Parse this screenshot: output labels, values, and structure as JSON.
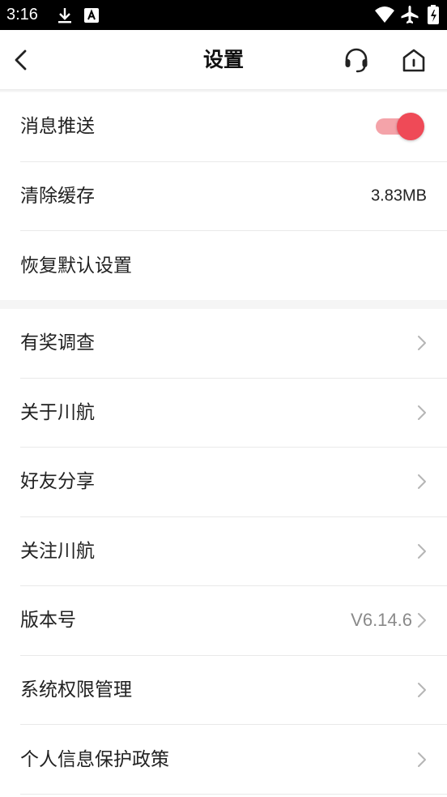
{
  "status_bar": {
    "time": "3:16",
    "icons": [
      "download-icon",
      "a-notification-icon",
      "wifi-icon",
      "airplane-icon",
      "battery-icon"
    ]
  },
  "header": {
    "title": "设置",
    "back_icon": "chevron-left-icon",
    "service_icon": "headset-icon",
    "home_icon": "home-icon"
  },
  "settings_group_1": [
    {
      "label": "消息推送",
      "control": "toggle",
      "on": true
    },
    {
      "label": "清除缓存",
      "value": "3.83MB"
    },
    {
      "label": "恢复默认设置"
    }
  ],
  "settings_group_2": [
    {
      "label": "有奖调查"
    },
    {
      "label": "关于川航"
    },
    {
      "label": "好友分享"
    },
    {
      "label": "关注川航"
    },
    {
      "label": "版本号",
      "value": "V6.14.6"
    },
    {
      "label": "系统权限管理"
    },
    {
      "label": "个人信息保护政策"
    }
  ],
  "colors": {
    "accent": "#ef4a57",
    "toggle_track": "#f4a3a9",
    "divider": "#e9e9e9",
    "section_gap": "#f5f5f5"
  }
}
